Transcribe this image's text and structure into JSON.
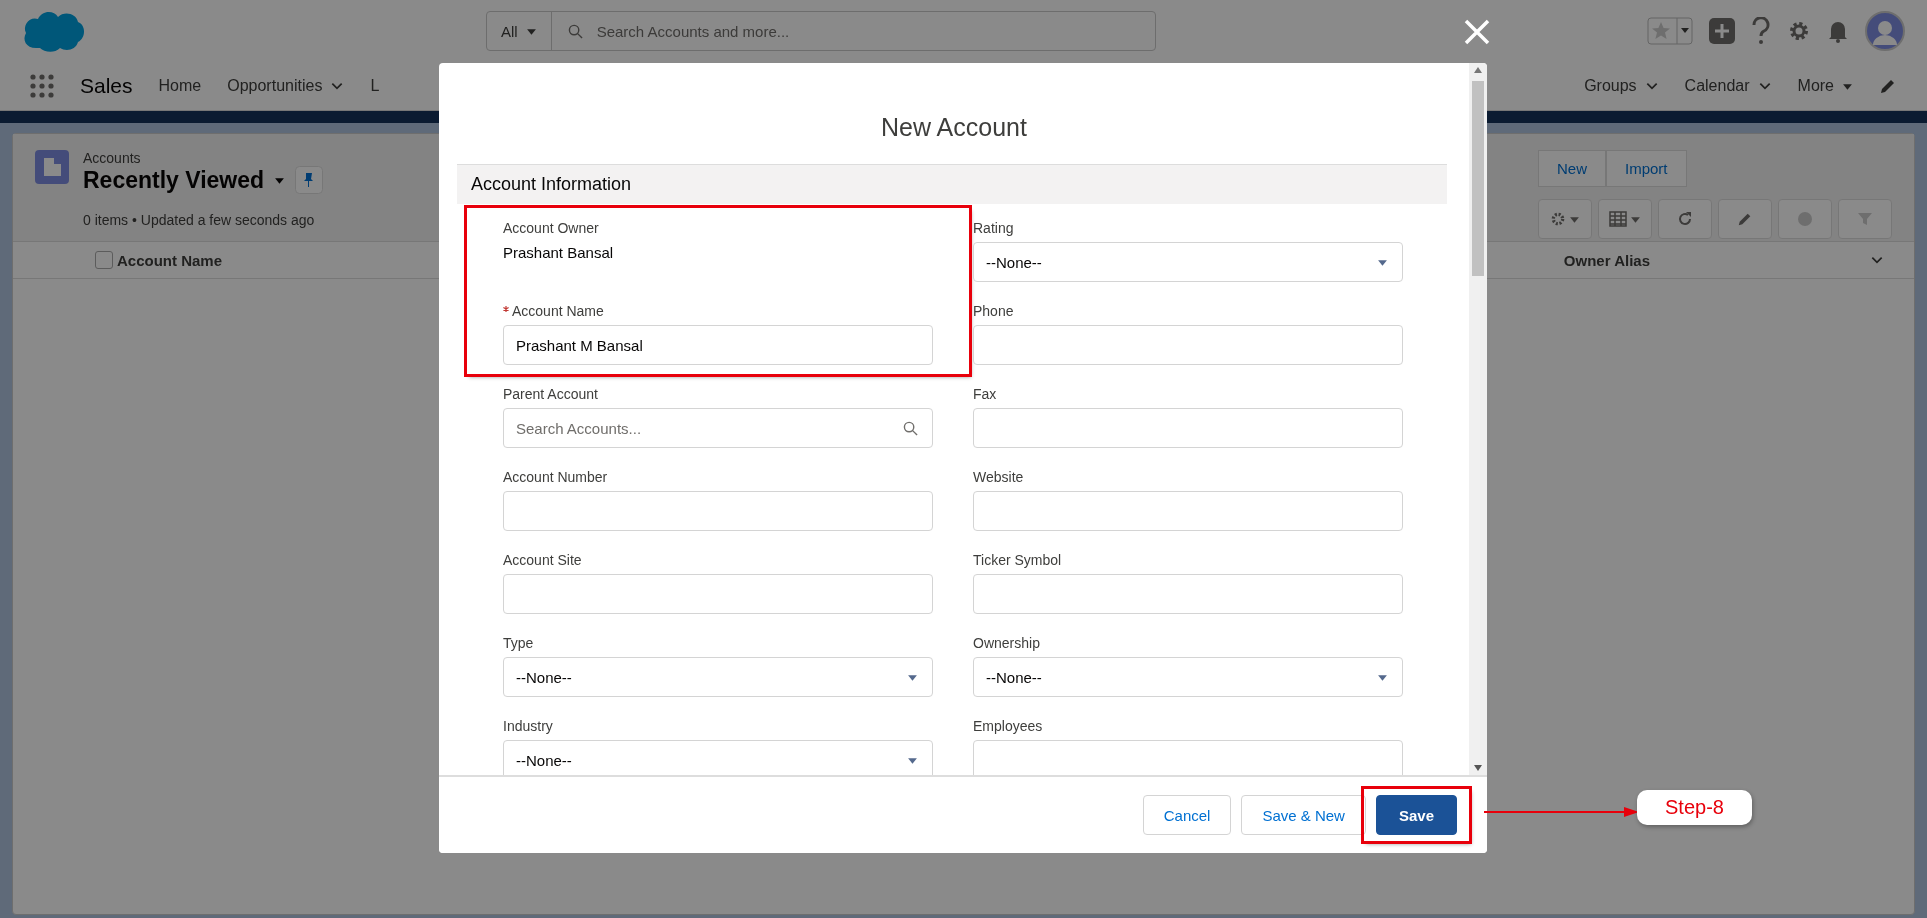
{
  "app": {
    "name": "Sales",
    "search_scope": "All",
    "search_placeholder": "Search Accounts and more...",
    "nav_left": [
      {
        "label": "Home",
        "kind": "link"
      },
      {
        "label": "Opportunities",
        "kind": "dropdown"
      },
      {
        "label": "L",
        "kind": "link"
      }
    ],
    "nav_right": [
      {
        "label": "Groups",
        "kind": "dropdown"
      },
      {
        "label": "Calendar",
        "kind": "dropdown"
      },
      {
        "label": "More",
        "kind": "overflow"
      }
    ]
  },
  "list": {
    "select_all_checked": false,
    "object": "Accounts",
    "view": "Recently Viewed",
    "status": "0 items • Updated a few seconds ago",
    "buttons": [
      "New",
      "Import"
    ],
    "columns": [
      "Account Name",
      "Owner Alias"
    ]
  },
  "modal": {
    "title": "New Account",
    "section": "Account Information",
    "left_fields": [
      {
        "label": "Account Owner",
        "kind": "readonly",
        "value": "Prashant Bansal",
        "required": false,
        "highlighted": true
      },
      {
        "label": "Account Name",
        "kind": "text",
        "value": "Prashant M Bansal",
        "required": true,
        "highlighted": true
      },
      {
        "label": "Parent Account",
        "kind": "lookup",
        "placeholder": "Search Accounts...",
        "required": false,
        "highlighted": false
      },
      {
        "label": "Account Number",
        "kind": "text",
        "required": false,
        "highlighted": false
      },
      {
        "label": "Account Site",
        "kind": "text",
        "required": false,
        "highlighted": false
      },
      {
        "label": "Type",
        "kind": "select",
        "value": "--None--",
        "required": false,
        "highlighted": false
      },
      {
        "label": "Industry",
        "kind": "select",
        "value": "--None--",
        "required": false,
        "highlighted": false
      }
    ],
    "right_fields": [
      {
        "label": "Rating",
        "kind": "select",
        "value": "--None--",
        "required": false,
        "highlighted": false
      },
      {
        "label": "Phone",
        "kind": "text",
        "required": false,
        "highlighted": false
      },
      {
        "label": "Fax",
        "kind": "text",
        "required": false,
        "highlighted": false
      },
      {
        "label": "Website",
        "kind": "text",
        "required": false,
        "highlighted": false
      },
      {
        "label": "Ticker Symbol",
        "kind": "text",
        "required": false,
        "highlighted": false
      },
      {
        "label": "Ownership",
        "kind": "select",
        "value": "--None--",
        "required": false,
        "highlighted": false
      },
      {
        "label": "Employees",
        "kind": "text",
        "required": false,
        "highlighted": false
      }
    ],
    "buttons": [
      {
        "label": "Cancel",
        "kind": "neutral",
        "highlighted": false
      },
      {
        "label": "Save & New",
        "kind": "neutral",
        "highlighted": false
      },
      {
        "label": "Save",
        "kind": "brand",
        "highlighted": true
      }
    ]
  },
  "annotation": {
    "label": "Step-8"
  }
}
